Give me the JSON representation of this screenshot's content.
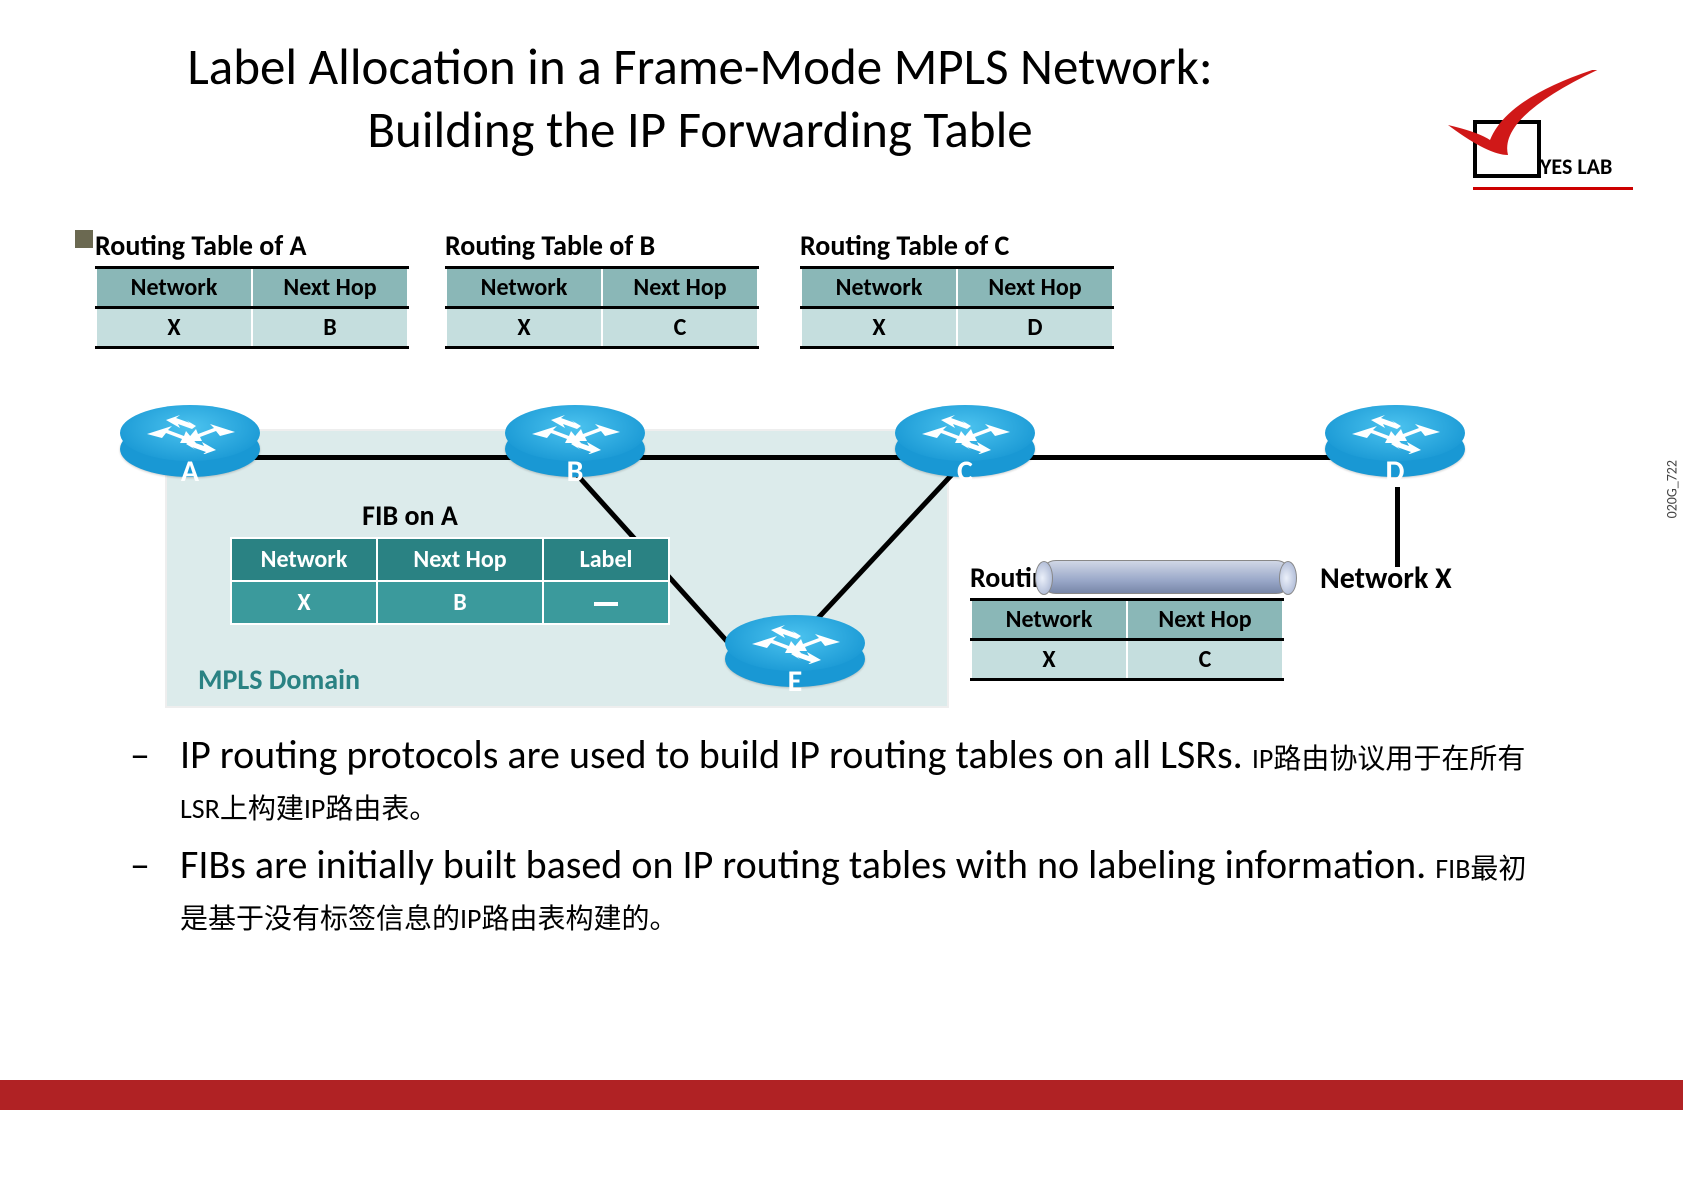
{
  "title_line1": "Label Allocation in a Frame-Mode MPLS Network:",
  "title_line2": "Building the IP Forwarding Table",
  "logo_text": "YES LAB",
  "side_code": "020G_722",
  "headers": {
    "network": "Network",
    "nexthop": "Next Hop",
    "label": "Label"
  },
  "routing_tables": {
    "A": {
      "title": "Routing Table of A",
      "network": "X",
      "nexthop": "B"
    },
    "B": {
      "title": "Routing Table of B",
      "network": "X",
      "nexthop": "C"
    },
    "C": {
      "title": "Routing Table of C",
      "network": "X",
      "nexthop": "D"
    },
    "E": {
      "title": "Routing Table of E",
      "network": "X",
      "nexthop": "C"
    }
  },
  "fib": {
    "title": "FIB on A",
    "network": "X",
    "nexthop": "B",
    "label": "—"
  },
  "domain_label": "MPLS Domain",
  "routers": {
    "A": "A",
    "B": "B",
    "C": "C",
    "D": "D",
    "E": "E"
  },
  "network_x_label": "Network X",
  "bullets": [
    {
      "en": "IP routing protocols are used to build IP routing tables  on all LSRs.",
      "cn": "IP路由协议用于在所有LSR上构建IP路由表。"
    },
    {
      "en": "FIBs are initially built based on IP routing tables with  no labeling information.",
      "cn": "FIB最初是基于没有标签信息的IP路由表构建的。"
    }
  ]
}
